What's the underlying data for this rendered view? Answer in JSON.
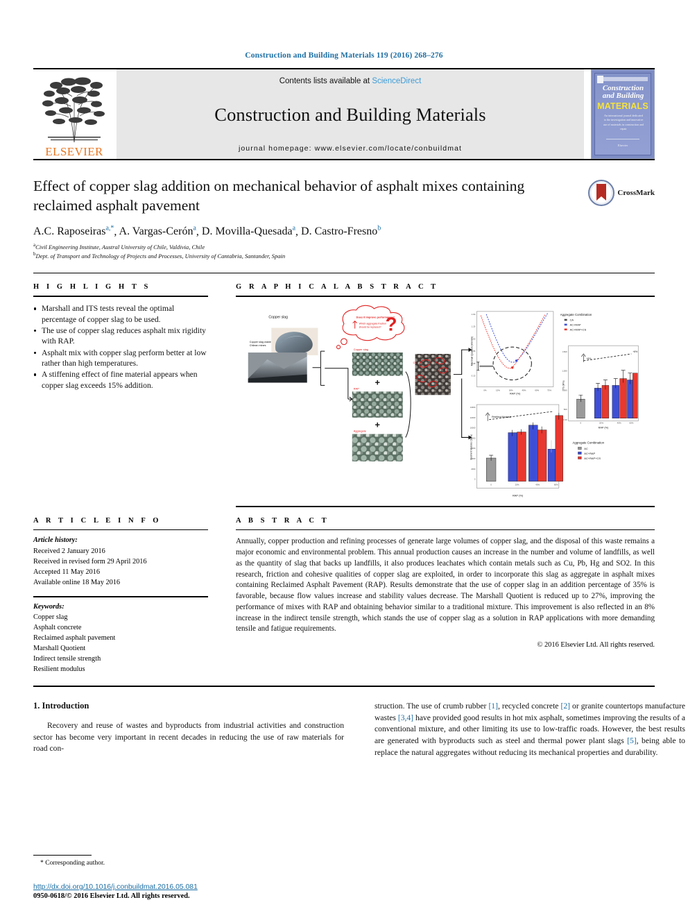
{
  "running_head": "Construction and Building Materials 119 (2016) 268–276",
  "masthead": {
    "publisher_name": "ELSEVIER",
    "publisher_icon": "elsevier-tree-logo",
    "contents_prefix": "Contents lists available at ",
    "contents_link": "ScienceDirect",
    "journal_title": "Construction and Building Materials",
    "homepage": "journal homepage: www.elsevier.com/locate/conbuildmat",
    "cover": {
      "line1": "Construction",
      "line2": "and Building",
      "line3": "MATERIALS",
      "blurb": "An international journal dedicated to the investigation and innovative use of materials in construction and repair",
      "footer": "Elsevier"
    },
    "accent_link_color": "#3b9cd9"
  },
  "title": {
    "text": "Effect of copper slag addition on mechanical behavior of asphalt mixes containing reclaimed asphalt pavement",
    "crossmark_label": "CrossMark",
    "crossmark_icon": "crossmark-badge-icon"
  },
  "authors": {
    "list": [
      {
        "name": "A.C. Raposeiras",
        "marks": "a,*"
      },
      {
        "name": "A. Vargas-Cerón",
        "marks": "a"
      },
      {
        "name": "D. Movilla-Quesada",
        "marks": "a"
      },
      {
        "name": "D. Castro-Fresno",
        "marks": "b"
      }
    ],
    "affiliations": [
      {
        "mark": "a",
        "text": "Civil Engineering Institute, Austral University of Chile, Valdivia, Chile"
      },
      {
        "mark": "b",
        "text": "Dept. of Transport and Technology of Projects and Processes, University of Cantabria, Santander, Spain"
      }
    ]
  },
  "highlights": {
    "heading": "H I G H L I G H T S",
    "items": [
      "Marshall and ITS tests reveal the optimal percentage of copper slag to be used.",
      "The use of copper slag reduces asphalt mix rigidity with RAP.",
      "Asphalt mix with copper slag perform better at low rather than high temperatures.",
      "A stiffening effect of fine material appears when copper slag exceeds 15% addition."
    ]
  },
  "graphical_abstract": {
    "heading": "G R A P H I C A L   A B S T R A C T",
    "labels": {
      "slag_source": "Copper slag",
      "source_caption": "Copper slag waste from Chilean mines",
      "thought_line1": "Does it improve performance?",
      "thought_line2": "Which aggregate fraction should be replaced?",
      "question_mark": "?",
      "copper_slag_tag": "Copper slag",
      "rap_tag": "RAP",
      "aggregate_tag": "Aggregate",
      "plus": "+"
    },
    "chart_data": [
      {
        "type": "line",
        "title": "",
        "xlabel": "RAP (%)",
        "ylabel": "Marshall Quotient (kN/mm)",
        "legend_title": "Aggregate Combination",
        "legend_position": "right",
        "series": [
          {
            "name": "CA",
            "color": "#4a4a4a"
          },
          {
            "name": "AC+RAP",
            "color": "#3e4fd6"
          },
          {
            "name": "AC+RAP+CS",
            "color": "#e8382f"
          }
        ],
        "annotation": "optimal zone"
      },
      {
        "type": "bar",
        "title": "",
        "xlabel": "RAP (%)",
        "ylabel": "Indirect Tensile Strength (kPa)",
        "legend_title": "Aggregate Combination",
        "categories": [
          "0",
          "20",
          "40",
          "60"
        ],
        "series": [
          {
            "name": "AC",
            "color": "#9a9a9a",
            "values": [
              640,
              0,
              0,
              0
            ]
          },
          {
            "name": "AC+RAP",
            "color": "#3e4fd6",
            "values": [
              0,
              1000,
              1040,
              1130
            ]
          },
          {
            "name": "AC+RAP+CS",
            "color": "#e8382f",
            "values": [
              0,
              1060,
              1170,
              1290
            ]
          }
        ],
        "annotation": "+8% increase"
      },
      {
        "type": "bar",
        "title": "",
        "xlabel": "RAP (%)",
        "ylabel": "Resilient Modulus (MPa)",
        "legend_title": "Aggregate Combination",
        "categories": [
          "0",
          "20",
          "40",
          "60"
        ],
        "series": [
          {
            "name": "AC",
            "color": "#9a9a9a",
            "values": [
              4500,
              0,
              0,
              0
            ]
          },
          {
            "name": "AC+RAP",
            "color": "#3e4fd6",
            "values": [
              0,
              8800,
              10200,
              6000
            ]
          },
          {
            "name": "AC+RAP+CS",
            "color": "#e8382f",
            "values": [
              0,
              8900,
              9400,
              11500
            ]
          }
        ],
        "annotation": "Resilient Modulus"
      }
    ]
  },
  "article_info": {
    "heading": "A R T I C L E   I N F O",
    "history_label": "Article history:",
    "history": [
      "Received 2 January 2016",
      "Received in revised form 29 April 2016",
      "Accepted 11 May 2016",
      "Available online 18 May 2016"
    ],
    "keywords_label": "Keywords:",
    "keywords": [
      "Copper slag",
      "Asphalt concrete",
      "Reclaimed asphalt pavement",
      "Marshall Quotient",
      "Indirect tensile strength",
      "Resilient modulus"
    ]
  },
  "abstract": {
    "heading": "A B S T R A C T",
    "text": "Annually, copper production and refining processes of generate large volumes of copper slag, and the disposal of this waste remains a major economic and environmental problem. This annual production causes an increase in the number and volume of landfills, as well as the quantity of slag that backs up landfills, it also produces leachates which contain metals such as Cu, Pb, Hg and SO2. In this research, friction and cohesive qualities of copper slag are exploited, in order to incorporate this slag as aggregate in asphalt mixes containing Reclaimed Asphalt Pavement (RAP). Results demonstrate that the use of copper slag in an addition percentage of 35% is favorable, because flow values increase and stability values decrease. The Marshall Quotient is reduced up to 27%, improving the performance of mixes with RAP and obtaining behavior similar to a traditional mixture. This improvement is also reflected in an 8% increase in the indirect tensile strength, which stands the use of copper slag as a solution in RAP applications with more demanding tensile and fatigue requirements.",
    "copyright": "© 2016 Elsevier Ltd. All rights reserved."
  },
  "introduction": {
    "heading": "1. Introduction",
    "paragraph_left": "Recovery and reuse of wastes and byproducts from industrial activities and construction sector has become very important in recent decades in reducing the use of raw materials for road con-",
    "paragraph_right_parts": [
      "struction. The use of crumb rubber ",
      "[1]",
      ", recycled concrete ",
      "[2]",
      " or granite countertops manufacture wastes ",
      "[3,4]",
      " have provided good results in hot mix asphalt, sometimes improving the results of a conventional mixture, and other limiting its use to low-traffic roads. However, the best results are generated with byproducts such as steel and thermal power plant slags ",
      "[5]",
      ", being able to replace the natural aggregates without reducing its mechanical properties and durability."
    ]
  },
  "footer": {
    "corresponding_mark": "*",
    "corresponding_text": "Corresponding author.",
    "doi": "http://dx.doi.org/10.1016/j.conbuildmat.2016.05.081",
    "issn": "0950-0618/© 2016 Elsevier Ltd. All rights reserved."
  }
}
